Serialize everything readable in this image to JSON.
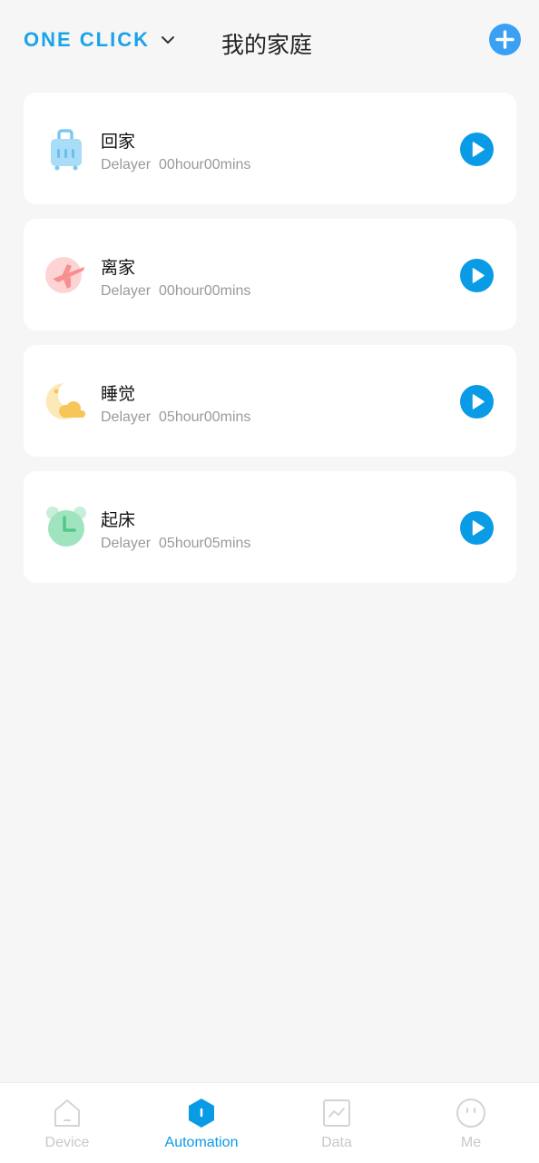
{
  "header": {
    "mode_label": "ONE CLICK",
    "home_title": "我的家庭",
    "add_icon": "plus-icon"
  },
  "scenes": [
    {
      "name": "回家",
      "subtitle": "Delayer  00hour00mins",
      "icon": "luggage-icon"
    },
    {
      "name": "离家",
      "subtitle": "Delayer  00hour00mins",
      "icon": "airplane-icon"
    },
    {
      "name": "睡觉",
      "subtitle": "Delayer  05hour00mins",
      "icon": "moon-cloud-icon"
    },
    {
      "name": "起床",
      "subtitle": "Delayer  05hour05mins",
      "icon": "alarm-clock-icon"
    }
  ],
  "bottom_nav": [
    {
      "label": "Device",
      "active": false
    },
    {
      "label": "Automation",
      "active": true
    },
    {
      "label": "Data",
      "active": false
    },
    {
      "label": "Me",
      "active": false
    }
  ],
  "colors": {
    "accent": "#0a9be6",
    "add_button": "#3aa0f3",
    "background": "#f6f6f6",
    "inactive_nav": "#c8c8c8"
  }
}
